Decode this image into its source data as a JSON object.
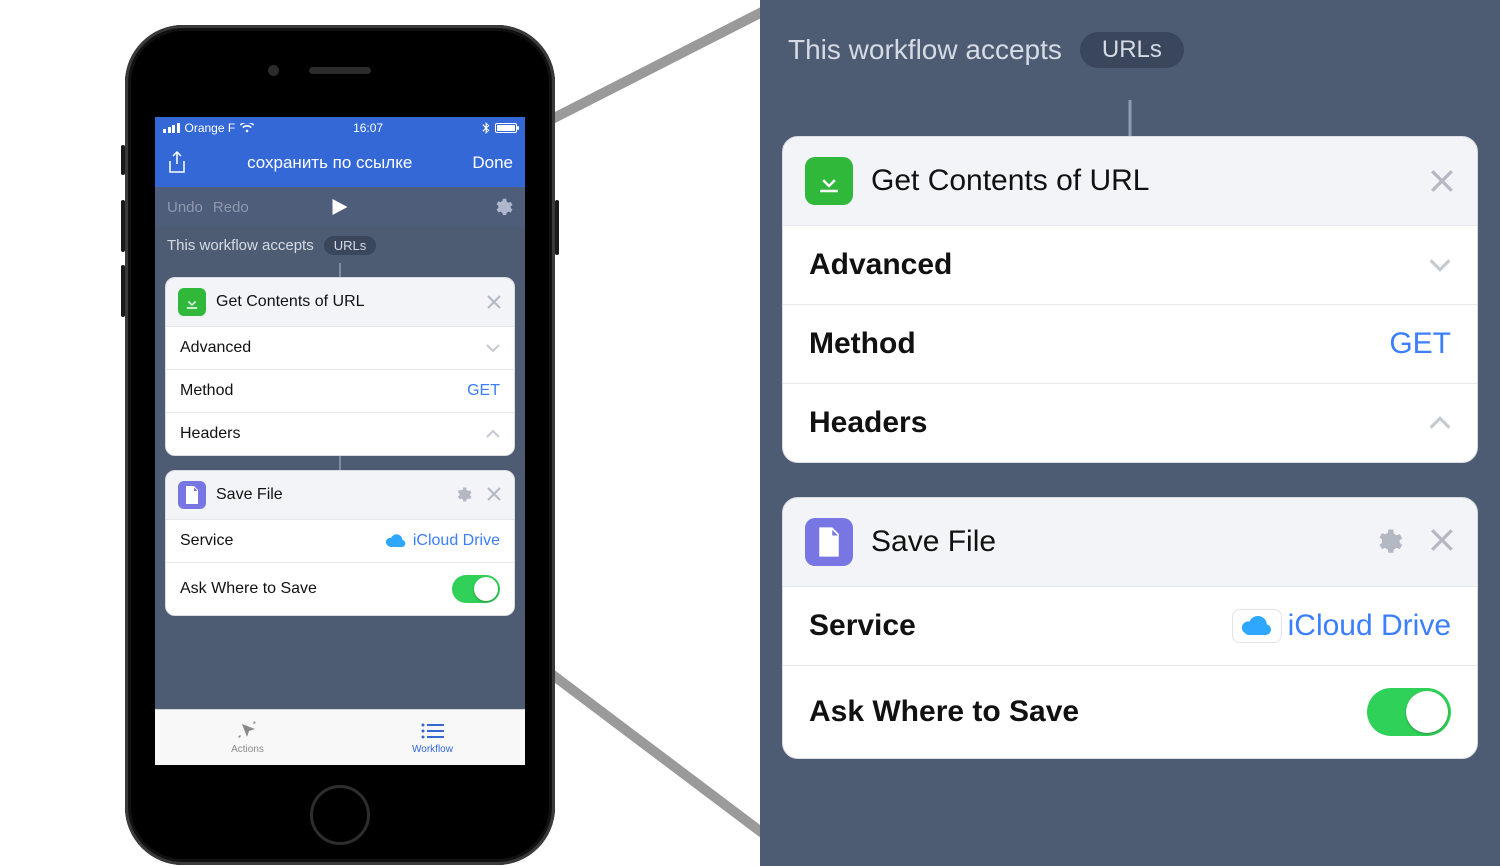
{
  "status": {
    "carrier": "Orange F",
    "time": "16:07"
  },
  "nav": {
    "title": "сохранить по ссылке",
    "done": "Done"
  },
  "toolbar": {
    "undo": "Undo",
    "redo": "Redo"
  },
  "accepts": {
    "label": "This workflow accepts",
    "type": "URLs"
  },
  "actions": {
    "getUrl": {
      "title": "Get Contents of URL",
      "rows": {
        "advanced": "Advanced",
        "method_label": "Method",
        "method_value": "GET",
        "headers": "Headers"
      }
    },
    "saveFile": {
      "title": "Save File",
      "rows": {
        "service_label": "Service",
        "service_value": "iCloud Drive",
        "ask_label": "Ask Where to Save",
        "ask_on": true
      }
    }
  },
  "tabs": {
    "actions": "Actions",
    "workflow": "Workflow"
  }
}
